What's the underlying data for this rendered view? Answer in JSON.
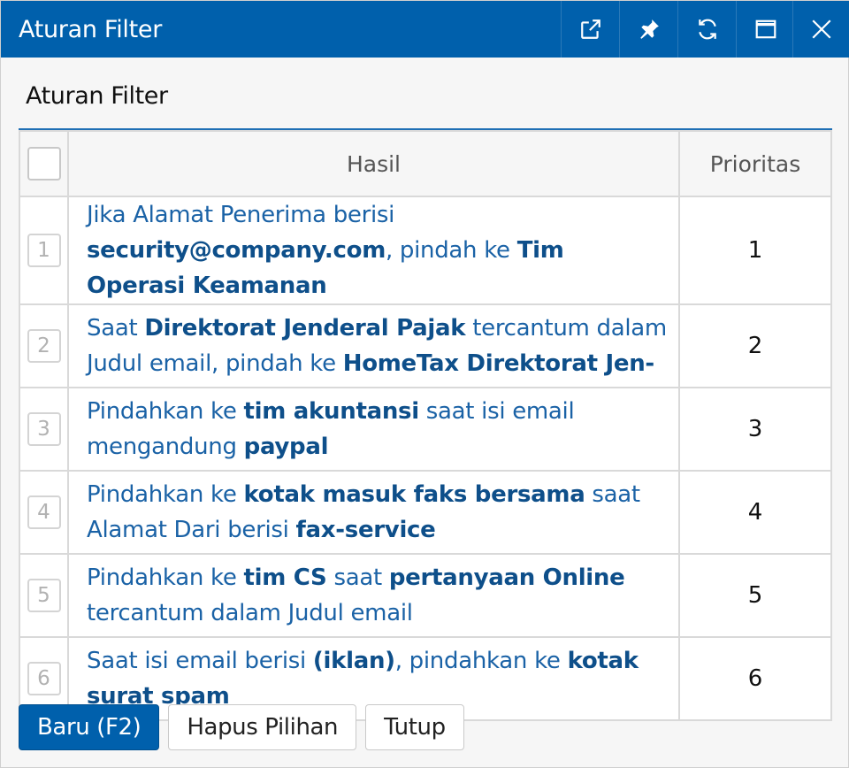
{
  "window": {
    "title": "Aturan Filter"
  },
  "titlebar_buttons": [
    {
      "name": "popout",
      "icon": "external-link-icon"
    },
    {
      "name": "pin",
      "icon": "pin-icon"
    },
    {
      "name": "refresh",
      "icon": "refresh-icon"
    },
    {
      "name": "maximize",
      "icon": "maximize-icon"
    },
    {
      "name": "close",
      "icon": "close-icon"
    }
  ],
  "section_title": "Aturan Filter",
  "table": {
    "headers": {
      "result": "Hasil",
      "priority": "Prioritas"
    },
    "rows": [
      {
        "num": "1",
        "priority": "1",
        "parts": [
          {
            "t": "Jika Alamat Penerima berisi "
          },
          {
            "t": "security@company.com",
            "b": true
          },
          {
            "t": ", pindah ke "
          },
          {
            "t": "Tim Operasi Keamanan",
            "b": true
          }
        ]
      },
      {
        "num": "2",
        "priority": "2",
        "parts": [
          {
            "t": "Saat "
          },
          {
            "t": "Direktorat Jenderal Pajak",
            "b": true
          },
          {
            "t": " tercantum dalam Judul email, pindah ke "
          },
          {
            "t": "HomeTax Direktorat Jen-",
            "b": true
          }
        ]
      },
      {
        "num": "3",
        "priority": "3",
        "parts": [
          {
            "t": "Pindahkan ke "
          },
          {
            "t": "tim akuntansi",
            "b": true
          },
          {
            "t": " saat isi email mengandung "
          },
          {
            "t": "paypal",
            "b": true
          }
        ]
      },
      {
        "num": "4",
        "priority": "4",
        "parts": [
          {
            "t": "Pindahkan ke "
          },
          {
            "t": "kotak masuk faks bersama",
            "b": true
          },
          {
            "t": " saat Alamat Dari berisi "
          },
          {
            "t": "fax-service",
            "b": true
          }
        ]
      },
      {
        "num": "5",
        "priority": "5",
        "parts": [
          {
            "t": "Pindahkan ke "
          },
          {
            "t": "tim CS",
            "b": true
          },
          {
            "t": " saat "
          },
          {
            "t": "pertanyaan Online",
            "b": true
          },
          {
            "t": " tercantum dalam Judul email"
          }
        ]
      },
      {
        "num": "6",
        "priority": "6",
        "parts": [
          {
            "t": "Saat isi email berisi "
          },
          {
            "t": "(iklan)",
            "b": true
          },
          {
            "t": ", pindahkan ke "
          },
          {
            "t": "kotak surat spam",
            "b": true
          }
        ]
      }
    ]
  },
  "footer": {
    "new_label": "Baru (F2)",
    "delete_label": "Hapus Pilihan",
    "close_label": "Tutup"
  },
  "colors": {
    "accent": "#0060ac",
    "link_text": "#1a62a6",
    "bold_text": "#0e4f8a"
  }
}
